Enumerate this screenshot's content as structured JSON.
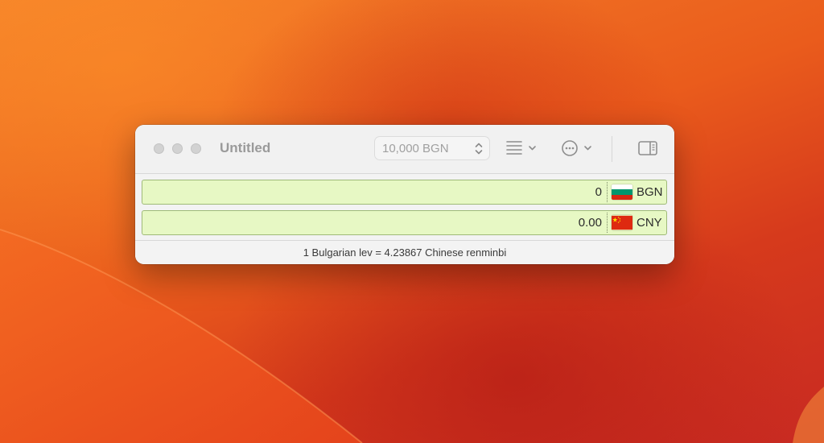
{
  "window": {
    "title": "Untitled"
  },
  "toolbar": {
    "amount_placeholder": "10,000 BGN",
    "list_menu_icon": "list-chevron-icon",
    "more_menu_icon": "ellipsis-circle-chevron-icon",
    "sidebar_icon": "sidebar-right-icon"
  },
  "rows": [
    {
      "value": "0",
      "code": "BGN",
      "flag": "bulgaria-flag-icon"
    },
    {
      "value": "0.00",
      "code": "CNY",
      "flag": "china-flag-icon"
    }
  ],
  "status": {
    "text": "1 Bulgarian lev = 4.23867 Chinese renminbi"
  },
  "colors": {
    "row_background": "#e7f8c4",
    "row_border": "#9fba78",
    "accent_wallpaper": "#ea5c1c"
  }
}
